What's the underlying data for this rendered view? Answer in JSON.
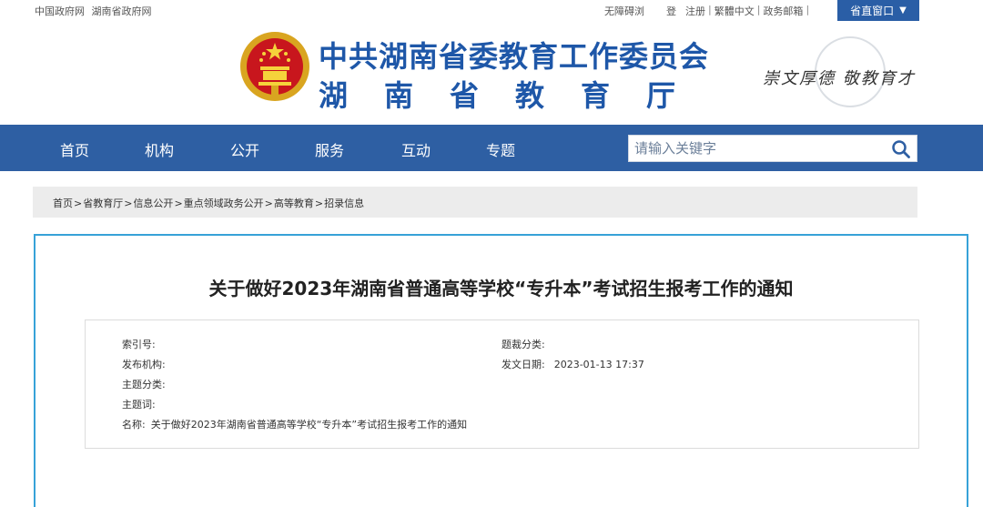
{
  "topbar": {
    "links_left": [
      "中国政府网",
      "湖南省政府网"
    ],
    "accessibility": "无障碍浏",
    "login": "登",
    "register": "注册",
    "traditional": "繁體中文",
    "gov_mail": "政务邮箱",
    "gov_window": "省直窗口"
  },
  "header": {
    "title_line1": "中共湖南省委教育工作委员会",
    "title_line2": "湖南省教育厅",
    "slogan": "崇文厚德  敬教育才"
  },
  "nav": {
    "items": [
      "首页",
      "机构",
      "公开",
      "服务",
      "互动",
      "专题"
    ],
    "search_placeholder": "请输入关键字"
  },
  "breadcrumb": [
    "首页",
    "省教育厅",
    "信息公开",
    "重点领域政务公开",
    "高等教育",
    "招录信息"
  ],
  "article": {
    "title": "关于做好2023年湖南省普通高等学校“专升本”考试招生报考工作的通知",
    "meta": {
      "index_label": "索引号:",
      "index_value": "",
      "category_label": "题裁分类:",
      "category_value": "",
      "publisher_label": "发布机构:",
      "publisher_value": "",
      "date_label": "发文日期:",
      "date_value": "2023-01-13 17:37",
      "topic_label": "主题分类:",
      "topic_value": "",
      "keywords_label": "主题词:",
      "keywords_value": "",
      "name_label": "名称:",
      "name_value": "关于做好2023年湖南省普通高等学校“专升本”考试招生报考工作的通知"
    }
  },
  "colors": {
    "nav_bg": "#2e5fa3",
    "title_blue": "#1e57a8",
    "panel_border": "#37a2d8"
  }
}
